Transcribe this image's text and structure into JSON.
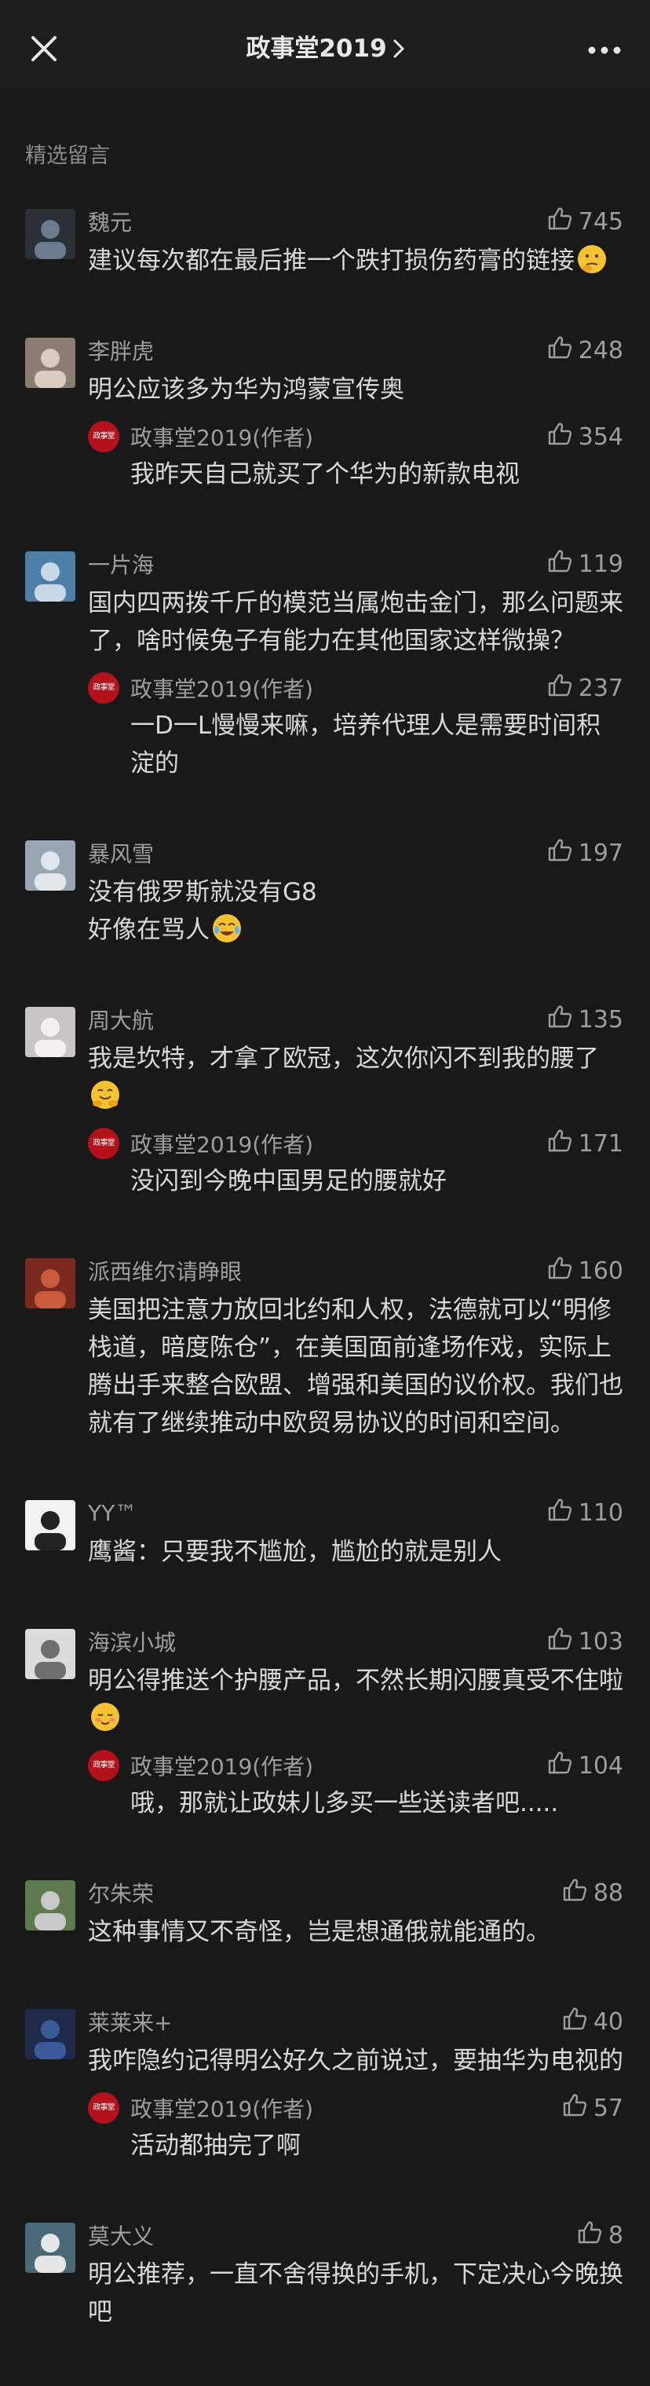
{
  "header": {
    "title": "政事堂2019",
    "close_icon": "close-icon",
    "more_icon": "more-dots-icon"
  },
  "section_label": "精选留言",
  "colors": {
    "background": "#191919",
    "author_badge": "#b3121a"
  },
  "comments": [
    {
      "nick": "魏元",
      "likes": "745",
      "text": "建议每次都在最后推一个跌打损伤药膏的链接",
      "emoji": "thinking-emoji"
    },
    {
      "nick": "李胖虎",
      "likes": "248",
      "text": "明公应该多为华为鸿蒙宣传奥",
      "reply": {
        "nick": "政事堂2019(作者)",
        "likes": "354",
        "text": "我昨天自己就买了个华为的新款电视",
        "badge": "政事堂"
      }
    },
    {
      "nick": "一片海",
      "likes": "119",
      "text": "国内四两拨千斤的模范当属炮击金门，那么问题来了，啥时候兔子有能力在其他国家这样微操？",
      "reply": {
        "nick": "政事堂2019(作者)",
        "likes": "237",
        "text": "一D一L慢慢来嘛，培养代理人是需要时间积淀的",
        "badge": "政事堂"
      }
    },
    {
      "nick": "暴风雪",
      "likes": "197",
      "text": "没有俄罗斯就没有G8\n好像在骂人",
      "emoji": "crying-laughing-emoji"
    },
    {
      "nick": "周大航",
      "likes": "135",
      "text": "我是坎特，才拿了欧冠，这次你闪不到我的腰了",
      "emoji": "hugging-emoji",
      "reply": {
        "nick": "政事堂2019(作者)",
        "likes": "171",
        "text": "没闪到今晚中国男足的腰就好",
        "badge": "政事堂"
      }
    },
    {
      "nick": "派西维尔请睁眼",
      "likes": "160",
      "text": "美国把注意力放回北约和人权，法德就可以“明修栈道，暗度陈仓”，在美国面前逢场作戏，实际上腾出手来整合欧盟、增强和美国的议价权。我们也就有了继续推动中欧贸易协议的时间和空间。"
    },
    {
      "nick": "YY™",
      "likes": "110",
      "text": "鹰酱：只要我不尴尬，尴尬的就是别人"
    },
    {
      "nick": "海滨小城",
      "likes": "103",
      "text": "明公得推送个护腰产品，不然长期闪腰真受不住啦",
      "emoji": "shy-emoji",
      "reply": {
        "nick": "政事堂2019(作者)",
        "likes": "104",
        "text": "哦，那就让政妹儿多买一些送读者吧.....",
        "badge": "政事堂"
      }
    },
    {
      "nick": "尔朱荣",
      "likes": "88",
      "text": "这种事情又不奇怪，岂是想通俄就能通的。"
    },
    {
      "nick": "莱莱来+",
      "likes": "40",
      "text": "我咋隐约记得明公好久之前说过，要抽华为电视的",
      "reply": {
        "nick": "政事堂2019(作者)",
        "likes": "57",
        "text": "活动都抽完了啊",
        "badge": "政事堂"
      }
    },
    {
      "nick": "莫大义",
      "likes": "8",
      "text": "明公推荐，一直不舍得换的手机，下定决心今晚换吧"
    }
  ]
}
